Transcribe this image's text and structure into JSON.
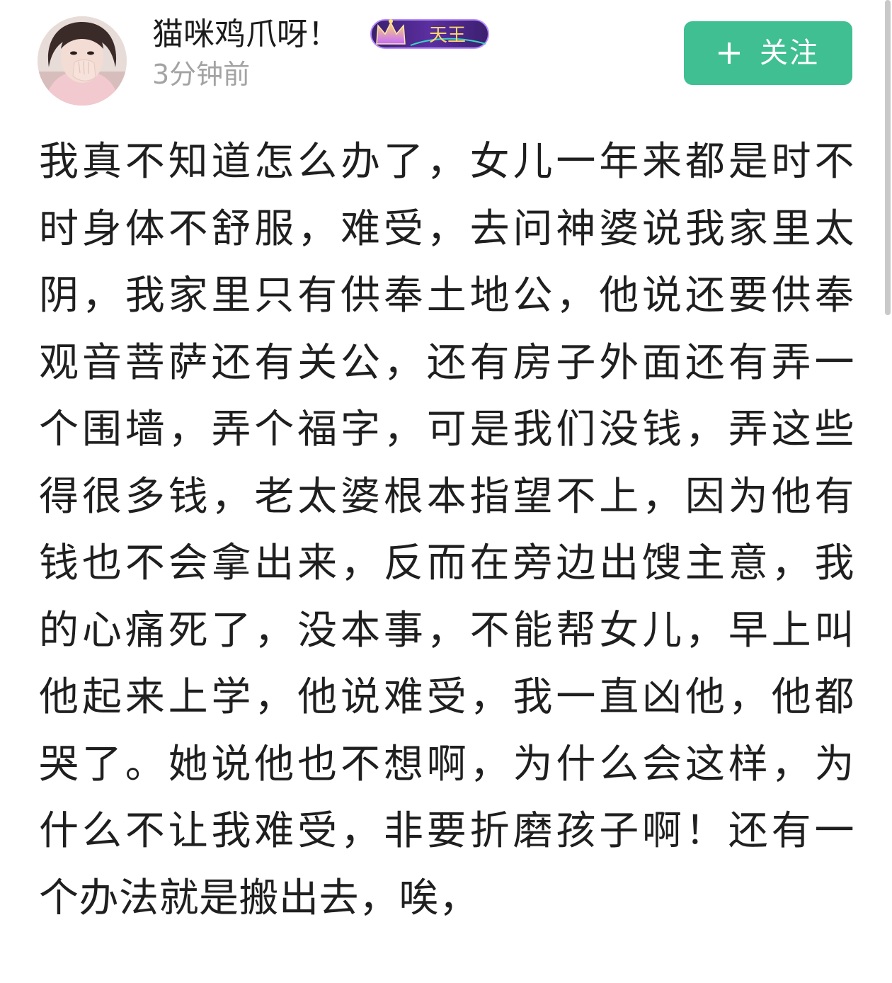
{
  "post": {
    "author": {
      "name": "猫咪鸡爪呀！",
      "badge_text": "天王",
      "time": "3分钟前"
    },
    "follow_button": {
      "label": "关注",
      "color": "#3fbf92"
    },
    "body_lines": [
      "我真不知道怎么办了，女儿一年来都是时不",
      "时身体不舒服，难受，去问神婆说我家里太",
      "阴，我家里只有供奉土地公，他说还要供奉",
      "观音菩萨还有关公，还有房子外面还有弄一",
      "个围墙，弄个福字，可是我们没钱，弄这些",
      "得很多钱，老太婆根本指望不上，因为他有",
      "钱也不会拿出来，反而在旁边出馊主意，我",
      "的心痛死了，没本事，不能帮女儿，早上叫",
      "他起来上学，他说难受，我一直凶他，他都",
      "哭了。她说他也不想啊，为什么会这样，为",
      "什么不让我难受，非要折磨孩子啊！还有一",
      "个办法就是搬出去，唉，"
    ]
  },
  "icons": {
    "follow": "plus-icon",
    "badge": "crown-rank-badge"
  },
  "colors": {
    "username": "#1b1b1b",
    "timestamp": "#a3a3a3",
    "body_text": "#1f1f1f",
    "accent": "#3fbf92"
  }
}
